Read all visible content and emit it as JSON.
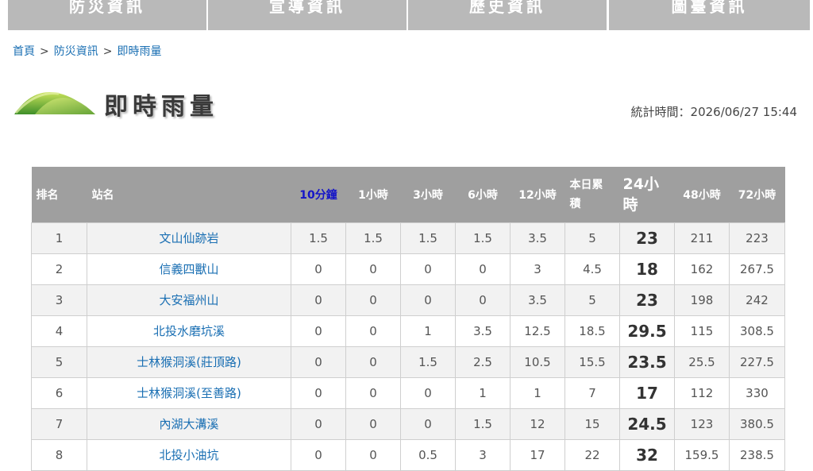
{
  "nav": {
    "tabs": [
      {
        "label": "防災資訊"
      },
      {
        "label": "宣導資訊"
      },
      {
        "label": "歷史資訊"
      },
      {
        "label": "圖臺資訊"
      }
    ]
  },
  "breadcrumb": {
    "items": [
      "首頁",
      "防災資訊",
      "即時雨量"
    ],
    "separator": ">"
  },
  "page": {
    "title": "即時雨量",
    "stat_time": "統計時間：2026/06/27 15:44"
  },
  "colors": {
    "header_bg": "#9f9f9f",
    "link": "#1a6fb3",
    "highlight_header": "#1414c8"
  },
  "table": {
    "headers": {
      "rank": "排名",
      "station": "站名",
      "m10": "10分鐘",
      "h1": "1小時",
      "h3": "3小時",
      "h6": "6小時",
      "h12": "12小時",
      "today_a": "本日累",
      "today_b": "積",
      "h24_a": "24小",
      "h24_b": "時",
      "h48": "48小時",
      "h72": "72小時"
    },
    "rows": [
      {
        "rank": "1",
        "station": "文山仙跡岩",
        "m10": "1.5",
        "h1": "1.5",
        "h3": "1.5",
        "h6": "1.5",
        "h12": "3.5",
        "today": "5",
        "h24": "23",
        "h48": "211",
        "h72": "223"
      },
      {
        "rank": "2",
        "station": "信義四獸山",
        "m10": "0",
        "h1": "0",
        "h3": "0",
        "h6": "0",
        "h12": "3",
        "today": "4.5",
        "h24": "18",
        "h48": "162",
        "h72": "267.5"
      },
      {
        "rank": "3",
        "station": "大安福州山",
        "m10": "0",
        "h1": "0",
        "h3": "0",
        "h6": "0",
        "h12": "3.5",
        "today": "5",
        "h24": "23",
        "h48": "198",
        "h72": "242"
      },
      {
        "rank": "4",
        "station": "北投水磨坑溪",
        "m10": "0",
        "h1": "0",
        "h3": "1",
        "h6": "3.5",
        "h12": "12.5",
        "today": "18.5",
        "h24": "29.5",
        "h48": "115",
        "h72": "308.5"
      },
      {
        "rank": "5",
        "station": "士林猴洞溪(莊頂路)",
        "m10": "0",
        "h1": "0",
        "h3": "1.5",
        "h6": "2.5",
        "h12": "10.5",
        "today": "15.5",
        "h24": "23.5",
        "h48": "25.5",
        "h72": "227.5"
      },
      {
        "rank": "6",
        "station": "士林猴洞溪(至善路)",
        "m10": "0",
        "h1": "0",
        "h3": "0",
        "h6": "1",
        "h12": "1",
        "today": "7",
        "h24": "17",
        "h48": "112",
        "h72": "330"
      },
      {
        "rank": "7",
        "station": "內湖大溝溪",
        "m10": "0",
        "h1": "0",
        "h3": "0",
        "h6": "1.5",
        "h12": "12",
        "today": "15",
        "h24": "24.5",
        "h48": "123",
        "h72": "380.5"
      },
      {
        "rank": "8",
        "station": "北投小油坑",
        "m10": "0",
        "h1": "0",
        "h3": "0.5",
        "h6": "3",
        "h12": "17",
        "today": "22",
        "h24": "32",
        "h48": "159.5",
        "h72": "238.5"
      }
    ]
  }
}
